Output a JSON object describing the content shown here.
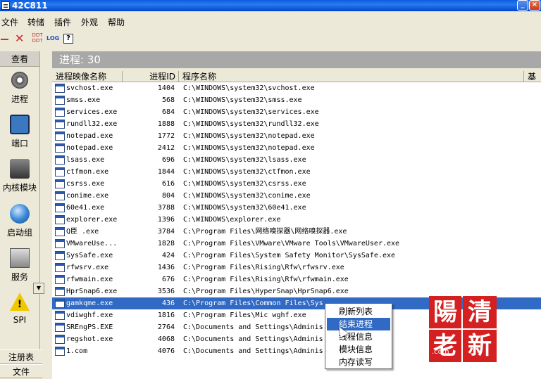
{
  "window": {
    "title": "42C811",
    "min": "_",
    "max": "□",
    "close": "×"
  },
  "menu": [
    "文件",
    "转储",
    "插件",
    "外观",
    "帮助"
  ],
  "toolbar": {
    "ddt_label": "DDT",
    "log_label": "LOG",
    "help_label": "?"
  },
  "leftnav": {
    "header": "查看",
    "items": [
      {
        "label": "进程",
        "icon": "gear-icon"
      },
      {
        "label": "端口",
        "icon": "port-icon"
      },
      {
        "label": "内核模块",
        "icon": "module-icon"
      },
      {
        "label": "启动组",
        "icon": "startup-icon"
      },
      {
        "label": "服务",
        "icon": "service-icon"
      },
      {
        "label": "SPI",
        "icon": "spi-warning-icon"
      }
    ],
    "spi_mark": "!",
    "scroll_arrow": "▼",
    "bottom_tabs": [
      "注册表",
      "文件"
    ]
  },
  "main": {
    "header": "进程: 30",
    "columns": [
      "进程映像名称",
      "进程ID",
      "程序名称",
      "基本"
    ]
  },
  "processes": [
    {
      "name": "svchost.exe",
      "pid": "1404",
      "path": "C:\\WINDOWS\\system32\\svchost.exe"
    },
    {
      "name": "smss.exe",
      "pid": "568",
      "path": "C:\\WINDOWS\\system32\\smss.exe"
    },
    {
      "name": "services.exe",
      "pid": "684",
      "path": "C:\\WINDOWS\\system32\\services.exe"
    },
    {
      "name": "rundll32.exe",
      "pid": "1888",
      "path": "C:\\WINDOWS\\system32\\rundll32.exe"
    },
    {
      "name": "notepad.exe",
      "pid": "1772",
      "path": "C:\\WINDOWS\\system32\\notepad.exe"
    },
    {
      "name": "notepad.exe",
      "pid": "2412",
      "path": "C:\\WINDOWS\\system32\\notepad.exe"
    },
    {
      "name": "lsass.exe",
      "pid": "696",
      "path": "C:\\WINDOWS\\system32\\lsass.exe"
    },
    {
      "name": "ctfmon.exe",
      "pid": "1844",
      "path": "C:\\WINDOWS\\system32\\ctfmon.exe"
    },
    {
      "name": "csrss.exe",
      "pid": "616",
      "path": "C:\\WINDOWS\\system32\\csrss.exe"
    },
    {
      "name": "conime.exe",
      "pid": "804",
      "path": "C:\\WINDOWS\\system32\\conime.exe"
    },
    {
      "name": "60e41.exe",
      "pid": "3788",
      "path": "C:\\WINDOWS\\system32\\60e41.exe"
    },
    {
      "name": "explorer.exe",
      "pid": "1396",
      "path": "C:\\WINDOWS\\explorer.exe"
    },
    {
      "name": "Q臣  .exe",
      "pid": "3784",
      "path": "C:\\Program Files\\网络嗅探器\\网络嗅探器.exe"
    },
    {
      "name": "VMwareUse...",
      "pid": "1828",
      "path": "C:\\Program Files\\VMware\\VMware Tools\\VMwareUser.exe"
    },
    {
      "name": "SysSafe.exe",
      "pid": "424",
      "path": "C:\\Program Files\\System Safety Monitor\\SysSafe.exe"
    },
    {
      "name": "rfwsrv.exe",
      "pid": "1436",
      "path": "C:\\Program Files\\Rising\\Rfw\\rfwsrv.exe"
    },
    {
      "name": "rfwmain.exe",
      "pid": "676",
      "path": "C:\\Program Files\\Rising\\Rfw\\rfwmain.exe"
    },
    {
      "name": "HprSnap6.exe",
      "pid": "3536",
      "path": "C:\\Program Files\\HyperSnap\\HprSnap6.exe"
    },
    {
      "name": "gamkqme.exe",
      "pid": "436",
      "path": "C:\\Program Files\\Common Files\\Sys..."
    },
    {
      "name": "vdiwghf.exe",
      "pid": "1816",
      "path": "C:\\Program Files\\Mic                 wghf.exe"
    },
    {
      "name": "SREngPS.EXE",
      "pid": "2764",
      "path": "C:\\Documents and Settings\\Adminis          g2.5\\SREn"
    },
    {
      "name": "regshot.exe",
      "pid": "4068",
      "path": "C:\\Documents and Settings\\Adminis          hot1_7_2\\"
    },
    {
      "name": "1.com",
      "pid": "4076",
      "path": "C:\\Documents and Settings\\Adminis        word_cn\\I"
    }
  ],
  "selected_row": 18,
  "context_menu": [
    "刷新列表",
    "结束进程",
    "线程信息",
    "模块信息",
    "内存读写"
  ],
  "context_menu_highlight": 1,
  "watermark": {
    "chars": [
      "陽",
      "清",
      "老",
      "新"
    ],
    "url": ".com"
  },
  "colors": {
    "selection": "#316ac5",
    "header_band": "#a8a8a8",
    "titlebar": "#0a5fe0",
    "stamp": "#d42020"
  }
}
